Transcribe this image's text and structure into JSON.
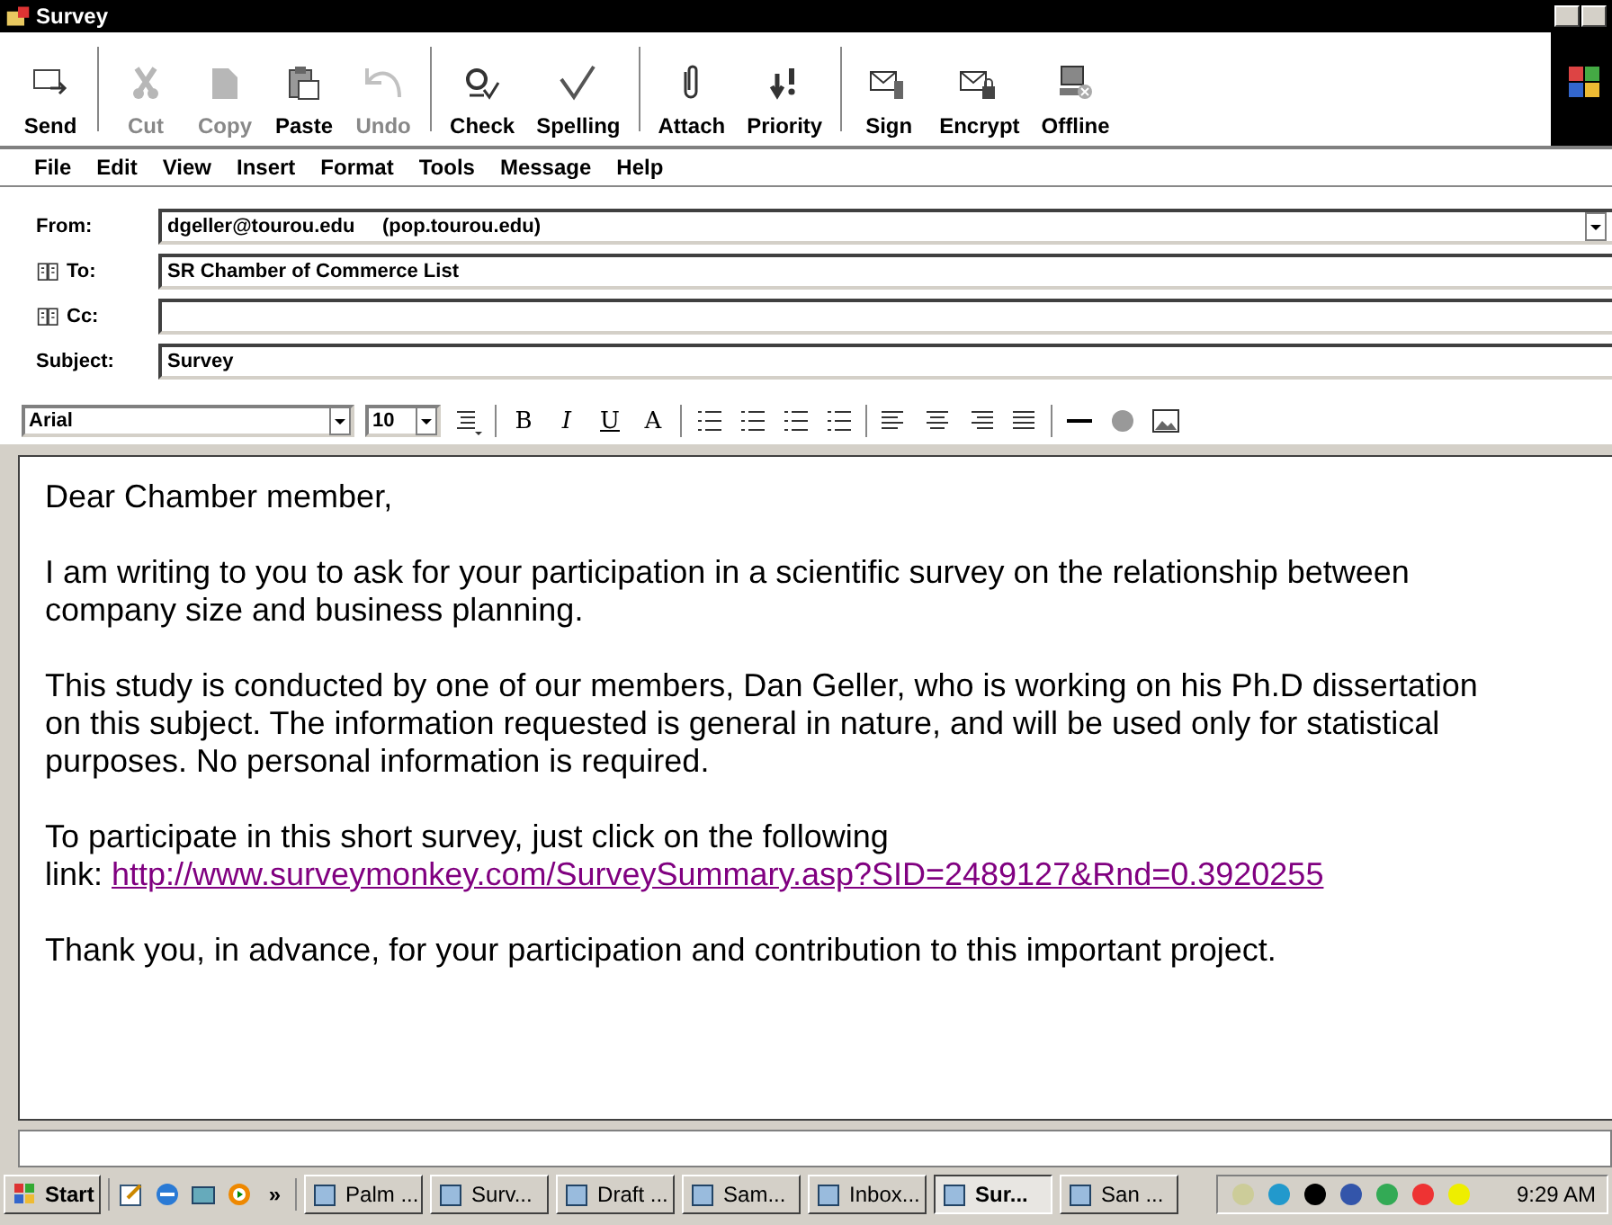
{
  "window": {
    "title": "Survey"
  },
  "toolbar": [
    {
      "label": "Send",
      "disabled": false
    },
    {
      "label": "Cut",
      "disabled": true
    },
    {
      "label": "Copy",
      "disabled": true
    },
    {
      "label": "Paste",
      "disabled": false
    },
    {
      "label": "Undo",
      "disabled": true
    },
    {
      "label": "Check",
      "disabled": false
    },
    {
      "label": "Spelling",
      "disabled": false
    },
    {
      "label": "Attach",
      "disabled": false
    },
    {
      "label": "Priority",
      "disabled": false
    },
    {
      "label": "Sign",
      "disabled": false
    },
    {
      "label": "Encrypt",
      "disabled": false
    },
    {
      "label": "Offline",
      "disabled": false
    }
  ],
  "menu": [
    "File",
    "Edit",
    "View",
    "Insert",
    "Format",
    "Tools",
    "Message",
    "Help"
  ],
  "fields": [
    {
      "label": "From:",
      "value": "dgeller@tourou.edu     (pop.tourou.edu)",
      "kind": "dropdown"
    },
    {
      "label": "To:",
      "value": "SR Chamber of Commerce List",
      "kind": "address"
    },
    {
      "label": "Cc:",
      "kind": "address"
    },
    {
      "label": "Subject:",
      "value": "Survey",
      "kind": "text"
    }
  ],
  "format_bar": {
    "font": "Arial",
    "size": "10",
    "style_buttons": [
      "B",
      "I",
      "U",
      "A"
    ]
  },
  "body": {
    "paragraphs": [
      {
        "text": "Dear Chamber member,"
      },
      {
        "text": "I am writing to you to ask for your participation in a scientific survey on the relationship between company size and business planning."
      },
      {
        "text": "This study is conducted by one of our members, Dan Geller, who is working on his Ph.D dissertation on this subject. The information requested is general in nature, and will be used only for statistical purposes.  No personal information is required."
      },
      {
        "text": "To participate in this short survey, just click on the following\nlink: ",
        "link": "http://www.surveymonkey.com/SurveySummary.asp?SID=2489127&Rnd=0.3920255"
      },
      {
        "text": "Thank you, in advance, for your participation and contribution to this important project."
      }
    ]
  },
  "taskbar": {
    "start": "Start",
    "more": "»",
    "tasks": [
      {
        "label": "Palm ...",
        "selected": false
      },
      {
        "label": "Surv...",
        "selected": false
      },
      {
        "label": "Draft ...",
        "selected": false
      },
      {
        "label": "Sam...",
        "selected": false
      },
      {
        "label": "Inbox...",
        "selected": false
      },
      {
        "label": "Sur...",
        "selected": true
      },
      {
        "label": "San ...",
        "selected": false
      }
    ],
    "clock": "9:29 AM"
  }
}
